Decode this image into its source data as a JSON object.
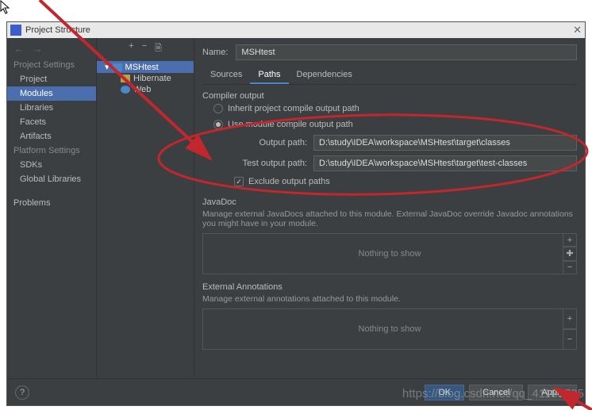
{
  "title": "Project Structure",
  "nav": {
    "projectSettings": "Project Settings",
    "project": "Project",
    "modules": "Modules",
    "libraries": "Libraries",
    "facets": "Facets",
    "artifacts": "Artifacts",
    "platformSettings": "Platform Settings",
    "sdks": "SDKs",
    "globalLibraries": "Global Libraries",
    "problems": "Problems"
  },
  "tree": {
    "module": "MSHtest",
    "hibernate": "Hibernate",
    "web": "Web"
  },
  "form": {
    "nameLabel": "Name:",
    "nameValue": "MSHtest",
    "tabs": {
      "sources": "Sources",
      "paths": "Paths",
      "dependencies": "Dependencies"
    },
    "compilerOutput": "Compiler output",
    "inherit": "Inherit project compile output path",
    "useModule": "Use module compile output path",
    "outputPathLabel": "Output path:",
    "outputPathValue": "D:\\study\\IDEA\\workspace\\MSHtest\\target\\classes",
    "testOutputLabel": "Test output path:",
    "testOutputValue": "D:\\study\\IDEA\\workspace\\MSHtest\\target\\test-classes",
    "exclude": "Exclude output paths",
    "javadocTitle": "JavaDoc",
    "javadocDesc": "Manage external JavaDocs attached to this module. External JavaDoc override Javadoc annotations you might have in your module.",
    "nothing": "Nothing to show",
    "extAnnotTitle": "External Annotations",
    "extAnnotDesc": "Manage external annotations attached to this module."
  },
  "footer": {
    "ok": "OK",
    "cancel": "Cancel",
    "apply": "Apply",
    "help": "?"
  },
  "watermark": "https://blog.csdn.net/qq_41185795",
  "colors": {
    "annotation": "#c1272d"
  }
}
